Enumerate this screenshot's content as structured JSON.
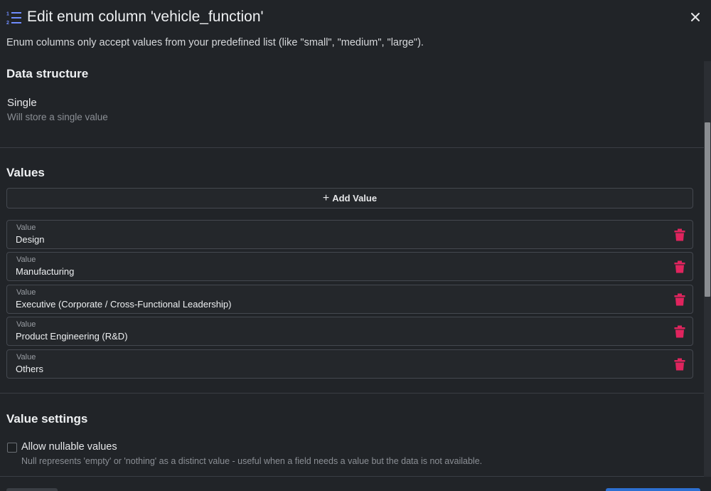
{
  "dialog": {
    "title": "Edit enum column 'vehicle_function'",
    "description": "Enum columns only accept values from your predefined list (like \"small\", \"medium\", \"large\").",
    "title_icon": "list-ordered-icon",
    "close_icon": "close-icon"
  },
  "data_structure": {
    "heading": "Data structure",
    "option_label": "Single",
    "option_help": "Will store a single value"
  },
  "values": {
    "heading": "Values",
    "add_label": "Add Value",
    "items": [
      {
        "caption": "Value",
        "value": "Design"
      },
      {
        "caption": "Value",
        "value": "Manufacturing"
      },
      {
        "caption": "Value",
        "value": "Executive (Corporate / Cross-Functional Leadership)"
      },
      {
        "caption": "Value",
        "value": "Product Engineering (R&D)"
      },
      {
        "caption": "Value",
        "value": "Others"
      }
    ]
  },
  "value_settings": {
    "heading": "Value settings",
    "nullable_label": "Allow nullable values",
    "nullable_checked": false,
    "nullable_help": "Null represents 'empty' or 'nothing' as a distinct value - useful when a field needs a value but the data is not available."
  },
  "colors": {
    "background": "#212428",
    "accent_icon": "#6f8cff",
    "delete": "#e0245e",
    "primary_button": "#2d6fd1"
  }
}
